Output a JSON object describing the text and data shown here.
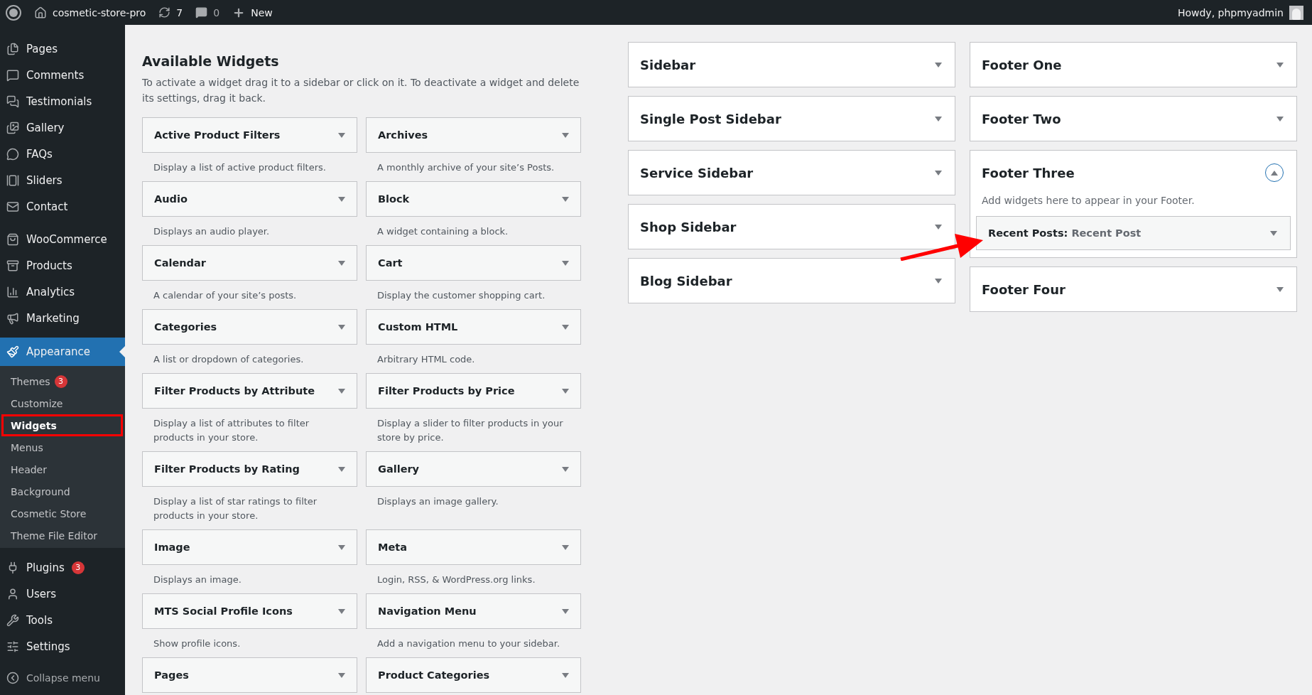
{
  "admin_bar": {
    "site": "cosmetic-store-pro",
    "updates": "7",
    "comments": "0",
    "new": "New",
    "greeting": "Howdy, phpmyadmin"
  },
  "menu": {
    "groups": [
      [
        {
          "label": "Pages",
          "selected": false
        },
        {
          "label": "Comments",
          "selected": false
        },
        {
          "label": "Testimonials",
          "selected": false
        },
        {
          "label": "Gallery",
          "selected": false
        },
        {
          "label": "FAQs",
          "selected": false
        },
        {
          "label": "Sliders",
          "selected": false
        },
        {
          "label": "Contact",
          "selected": false
        }
      ],
      [
        {
          "label": "WooCommerce",
          "selected": false
        },
        {
          "label": "Products",
          "selected": false
        },
        {
          "label": "Analytics",
          "selected": false
        },
        {
          "label": "Marketing",
          "selected": false
        }
      ],
      [
        {
          "label": "Appearance",
          "selected": true,
          "expanded": true,
          "children": [
            {
              "label": "Themes",
              "badge": "3",
              "selected": false,
              "highlighted": false
            },
            {
              "label": "Customize",
              "selected": false,
              "highlighted": false
            },
            {
              "label": "Widgets",
              "selected": true,
              "highlighted": true
            },
            {
              "label": "Menus",
              "selected": false,
              "highlighted": false
            },
            {
              "label": "Header",
              "selected": false,
              "highlighted": false
            },
            {
              "label": "Background",
              "selected": false,
              "highlighted": false
            },
            {
              "label": "Cosmetic Store",
              "selected": false,
              "highlighted": false
            },
            {
              "label": "Theme File Editor",
              "selected": false,
              "highlighted": false
            }
          ]
        }
      ],
      [
        {
          "label": "Plugins",
          "badge": "3",
          "selected": false
        },
        {
          "label": "Users",
          "selected": false
        },
        {
          "label": "Tools",
          "selected": false
        },
        {
          "label": "Settings",
          "selected": false
        }
      ]
    ],
    "collapse": "Collapse menu"
  },
  "available": {
    "title": "Available Widgets",
    "intro": "To activate a widget drag it to a sidebar or click on it. To deactivate a widget and delete its settings, drag it back.",
    "widgets": [
      {
        "name": "Active Product Filters",
        "description": "Display a list of active product filters."
      },
      {
        "name": "Archives",
        "description": "A monthly archive of your site’s Posts."
      },
      {
        "name": "Audio",
        "description": "Displays an audio player."
      },
      {
        "name": "Block",
        "description": "A widget containing a block."
      },
      {
        "name": "Calendar",
        "description": "A calendar of your site’s posts."
      },
      {
        "name": "Cart",
        "description": "Display the customer shopping cart."
      },
      {
        "name": "Categories",
        "description": "A list or dropdown of categories."
      },
      {
        "name": "Custom HTML",
        "description": "Arbitrary HTML code."
      },
      {
        "name": "Filter Products by Attribute",
        "description": "Display a list of attributes to filter products in your store."
      },
      {
        "name": "Filter Products by Price",
        "description": "Display a slider to filter products in your store by price."
      },
      {
        "name": "Filter Products by Rating",
        "description": "Display a list of star ratings to filter products in your store."
      },
      {
        "name": "Gallery",
        "description": "Displays an image gallery."
      },
      {
        "name": "Image",
        "description": "Displays an image."
      },
      {
        "name": "Meta",
        "description": "Login, RSS, & WordPress.org links."
      },
      {
        "name": "MTS Social Profile Icons",
        "description": "Show profile icons."
      },
      {
        "name": "Navigation Menu",
        "description": "Add a navigation menu to your sidebar."
      },
      {
        "name": "Pages"
      },
      {
        "name": "Product Categories"
      }
    ]
  },
  "areas": {
    "columns": [
      [
        {
          "name": "Sidebar",
          "expanded": false
        },
        {
          "name": "Single Post Sidebar",
          "expanded": false
        },
        {
          "name": "Service Sidebar",
          "expanded": false
        },
        {
          "name": "Shop Sidebar",
          "expanded": false
        },
        {
          "name": "Blog Sidebar",
          "expanded": false
        }
      ],
      [
        {
          "name": "Footer One",
          "expanded": false
        },
        {
          "name": "Footer Two",
          "expanded": false
        },
        {
          "name": "Footer Three",
          "expanded": true,
          "description": "Add widgets here to appear in your Footer.",
          "widgets": [
            {
              "name": "Recent Posts:",
              "title": "Recent Post",
              "highlighted": true
            }
          ]
        },
        {
          "name": "Footer Four",
          "expanded": false
        }
      ]
    ]
  }
}
